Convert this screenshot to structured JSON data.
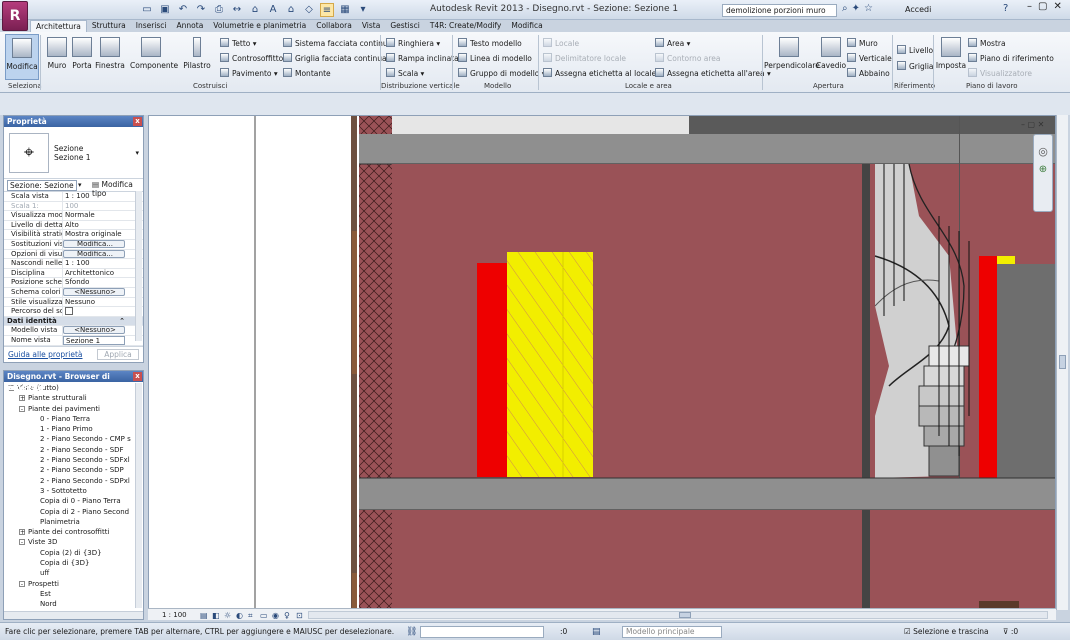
{
  "window": {
    "title": "Autodesk Revit 2013 -    Disegno.rvt - Sezione: Sezione 1"
  },
  "search": {
    "value": "demolizione porzioni muro"
  },
  "user": {
    "login": "Accedi"
  },
  "tabs": [
    "Architettura",
    "Struttura",
    "Inserisci",
    "Annota",
    "Volumetrie e planimetria",
    "Collabora",
    "Vista",
    "Gestisci",
    "T4R: Create/Modify",
    "Modifica"
  ],
  "ribbon": {
    "seleziona": {
      "big": "Modifica",
      "title": "Seleziona"
    },
    "costruisci": {
      "big": [
        "Muro",
        "Porta",
        "Finestra",
        "Componente",
        "Pilastro"
      ],
      "small": [
        "Tetto",
        "Controsoffitto",
        "Pavimento",
        "Sistema facciata continua",
        "Griglia facciata continua",
        "Montante"
      ],
      "title": "Costruisci"
    },
    "distribuzione": {
      "small": [
        "Ringhiera",
        "Rampa inclinata",
        "Scala"
      ],
      "title": "Distribuzione verticale"
    },
    "modello": {
      "small": [
        "Testo modello",
        "Linea di modello",
        "Gruppo di modello"
      ],
      "title": "Modello"
    },
    "locale": {
      "small": [
        "Locale",
        "Delimitatore locale",
        "Assegna etichetta  al locale",
        "Area",
        "Contorno area",
        "Assegna etichetta  all'area"
      ],
      "title": "Locale e area"
    },
    "apertura": {
      "big": [
        "Perpendicolare",
        "Cavedio"
      ],
      "small": [
        "Muro",
        "Verticale",
        "Abbaino"
      ],
      "title": "Apertura"
    },
    "riferimento": {
      "small": [
        "Livello",
        "Griglia"
      ],
      "title": "Riferimento"
    },
    "piano": {
      "big": "Imposta",
      "small": [
        "Mostra",
        "Piano di riferimento",
        "Visualizzatore"
      ],
      "title": "Piano di lavoro"
    }
  },
  "properties": {
    "title": "Proprietà",
    "type_line1": "Sezione",
    "type_line2": "Sezione 1",
    "selector": "Sezione: Sezione",
    "edit_type": "Modifica tipo",
    "rows": [
      {
        "k": "Scala vista",
        "v": "1 : 100"
      },
      {
        "k": "Scala 1:",
        "v": "100",
        "dis": true
      },
      {
        "k": "Visualizza modello",
        "v": "Normale"
      },
      {
        "k": "Livello di dettaglio",
        "v": "Alto"
      },
      {
        "k": "Visibilità stratigr...",
        "v": "Mostra originale"
      },
      {
        "k": "Sostituzioni visi...",
        "v": "Modifica...",
        "btn": true
      },
      {
        "k": "Opzioni di visua...",
        "v": "Modifica...",
        "btn": true
      },
      {
        "k": "Nascondi nelle ...",
        "v": "1 : 100"
      },
      {
        "k": "Disciplina",
        "v": "Architettonico"
      },
      {
        "k": "Posizione sche...",
        "v": "Sfondo"
      },
      {
        "k": "Schema colori",
        "v": "<Nessuno>",
        "btn": true
      },
      {
        "k": "Stile visualizzazi...",
        "v": "Nessuno"
      },
      {
        "k": "Percorso del sole",
        "v": "",
        "check": true
      }
    ],
    "section": "Dati identità",
    "rows2": [
      {
        "k": "Modello vista",
        "v": "<Nessuno>",
        "btn": true
      },
      {
        "k": "Nome vista",
        "v": "Sezione 1",
        "box": true
      }
    ],
    "help_link": "Guida alle proprietà",
    "apply": "Applica"
  },
  "browser": {
    "title": "Disegno.rvt - Browser di progetto",
    "items": [
      {
        "d": 0,
        "t": "-",
        "label": "Viste (tutto)"
      },
      {
        "d": 1,
        "t": "+",
        "label": "Piante strutturali"
      },
      {
        "d": 1,
        "t": "-",
        "label": "Piante dei pavimenti"
      },
      {
        "d": 2,
        "label": "0 - Piano Terra"
      },
      {
        "d": 2,
        "label": "1 - Piano Primo"
      },
      {
        "d": 2,
        "label": "2 - Piano Secondo - CMP s"
      },
      {
        "d": 2,
        "label": "2 - Piano Secondo - SDF"
      },
      {
        "d": 2,
        "label": "2 - Piano Secondo - SDFxl"
      },
      {
        "d": 2,
        "label": "2 - Piano Secondo - SDP"
      },
      {
        "d": 2,
        "label": "2 - Piano Secondo - SDPxl"
      },
      {
        "d": 2,
        "label": "3 - Sottotetto"
      },
      {
        "d": 2,
        "label": "Copia di 0 - Piano Terra"
      },
      {
        "d": 2,
        "label": "Copia di 2 - Piano Second"
      },
      {
        "d": 2,
        "label": "Planimetria"
      },
      {
        "d": 1,
        "t": "+",
        "label": "Piante dei controsoffitti"
      },
      {
        "d": 1,
        "t": "-",
        "label": "Viste 3D"
      },
      {
        "d": 2,
        "label": "Copia (2) di {3D}"
      },
      {
        "d": 2,
        "label": "Copia di {3D}"
      },
      {
        "d": 2,
        "label": "uff"
      },
      {
        "d": 1,
        "t": "-",
        "label": "Prospetti"
      },
      {
        "d": 2,
        "label": "Est"
      },
      {
        "d": 2,
        "label": "Nord"
      }
    ]
  },
  "viewbar": {
    "scale": "1 : 100"
  },
  "status": {
    "message": "Fare clic per selezionare, premere TAB per alternare, CTRL per aggiungere e MAIUSC per deselezionare.",
    "count": ":0",
    "model": "Modello principale",
    "press_select": "Selezione e trascina",
    "filter": ":0"
  },
  "colors": {
    "wall": "#9a5257",
    "slab": "#8f8f8f",
    "yellow": "#f2ee00",
    "red": "#ee0000"
  }
}
